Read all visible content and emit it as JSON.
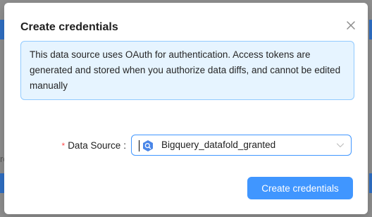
{
  "modal": {
    "title": "Create credentials",
    "info_text": "This data source uses OAuth for authentication. Access tokens are generated and stored when you authorize data diffs, and cannot be edited manually",
    "form": {
      "data_source_label": "Data Source",
      "data_source_colon": ":",
      "required_mark": "*",
      "data_source_value": "Bigquery_datafold_granted",
      "data_source_icon": "bigquery-icon"
    },
    "submit_label": "Create credentials",
    "close_icon": "close-icon"
  },
  "background": {
    "partial_text": "ro"
  },
  "colors": {
    "primary": "#4096ff",
    "info_bg": "#e6f4ff",
    "info_border": "#91caff",
    "required": "#ff4d4f"
  }
}
